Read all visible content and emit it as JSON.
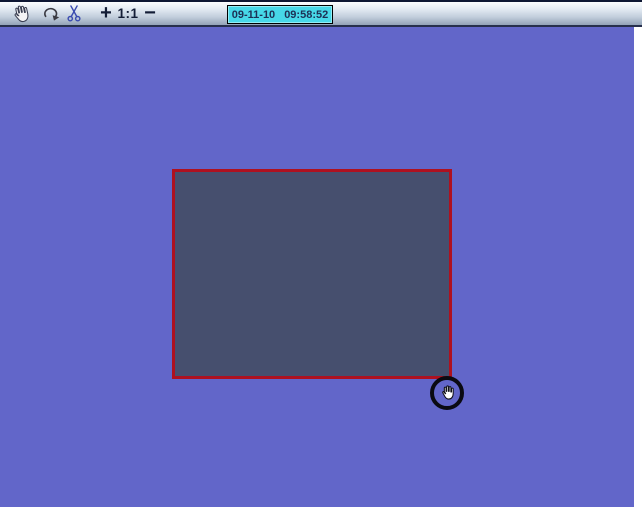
{
  "toolbar": {
    "tools": {
      "pan_icon": "hand-icon",
      "redo_icon": "redo-arrow-icon",
      "cut_icon": "scissors-icon"
    },
    "zoom_in_label": "+",
    "zoom_actual_label": "1:1",
    "zoom_out_label": "−",
    "datetime": {
      "date": "09-11-10",
      "time": "09:58:52"
    }
  },
  "canvas": {
    "background_color": "#6266c9",
    "selection_region": {
      "fill_color": "#464f6e",
      "border_color": "#ae1120"
    },
    "cursor": {
      "type": "hand-cursor",
      "highlight": "black-circle"
    }
  },
  "colors": {
    "toolbar_text": "#131d36",
    "datetime_background": "#47d8e8",
    "datetime_text": "#1d3055"
  }
}
